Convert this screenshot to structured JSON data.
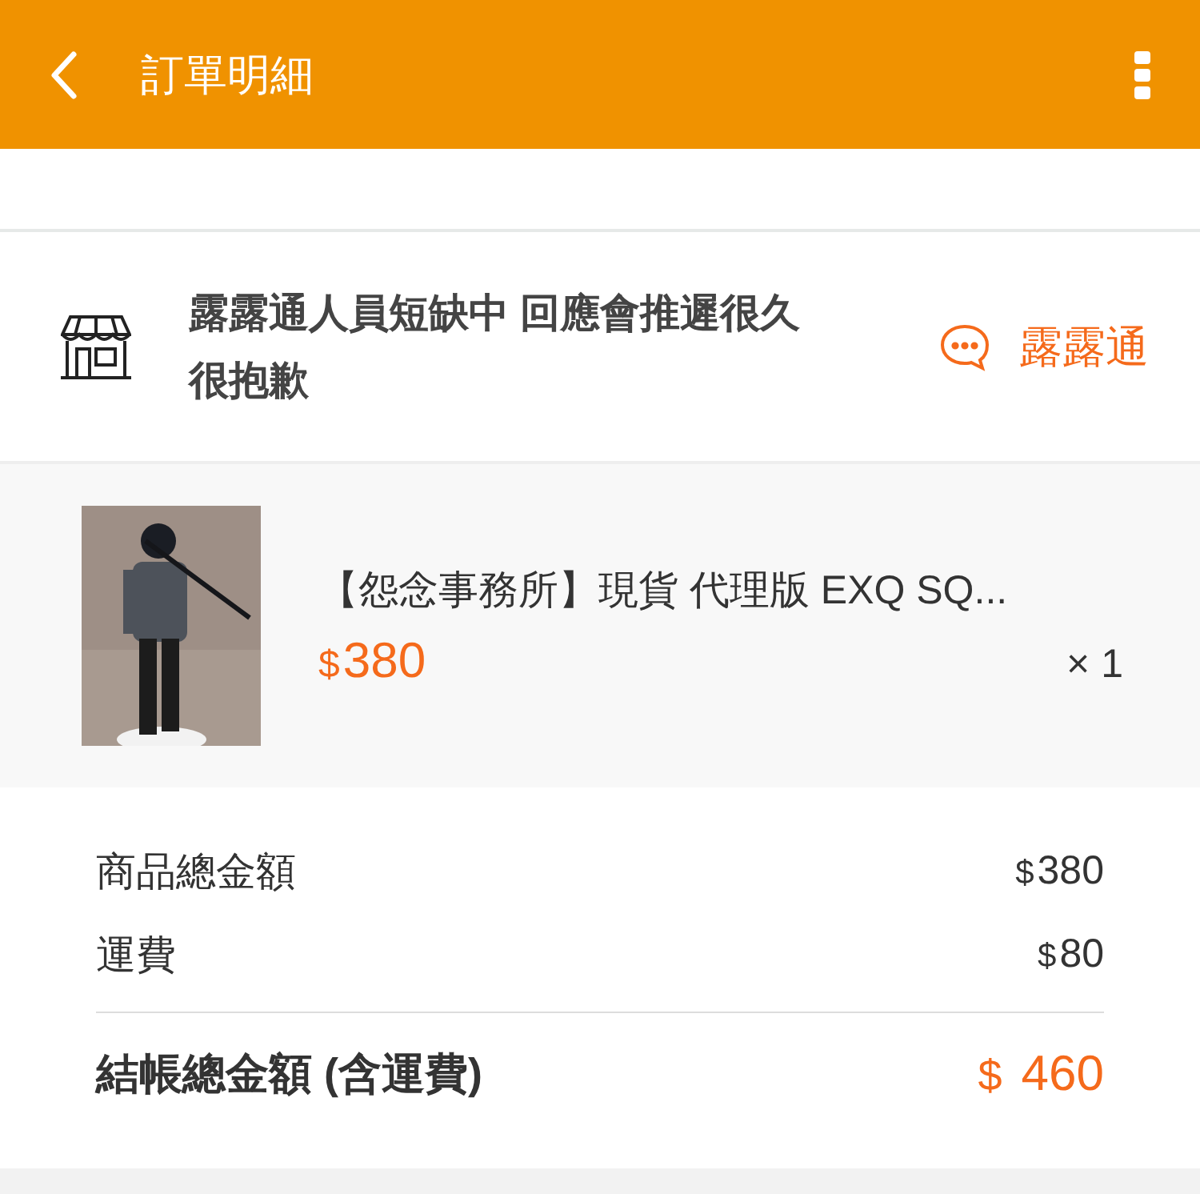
{
  "header": {
    "title": "訂單明細"
  },
  "shop": {
    "notice": "露露通人員短缺中 回應會推遲很久很抱歉",
    "chat_label": "露露通"
  },
  "product": {
    "name": "【怨念事務所】現貨 代理版 EXQ SQ...",
    "currency": "$",
    "price": "380",
    "quantity": "× 1"
  },
  "summary": {
    "rows": [
      {
        "label": "商品總金額",
        "currency": "$",
        "amount": "380"
      },
      {
        "label": "運費",
        "currency": "$",
        "amount": "80"
      }
    ],
    "total": {
      "label": "結帳總金額 (含運費)",
      "currency": "$",
      "amount": "460"
    }
  }
}
